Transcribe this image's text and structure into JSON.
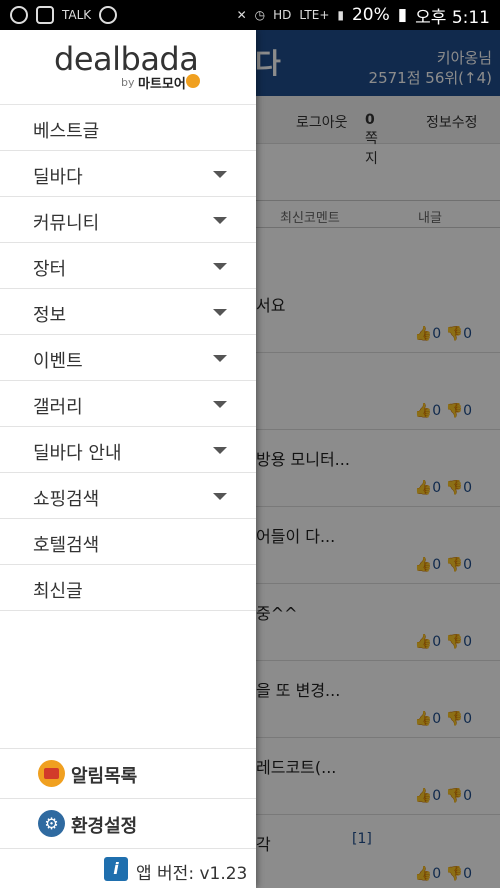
{
  "status_bar": {
    "battery": "20%",
    "time": "오후 5:11",
    "lte": "LTE+",
    "talk": "TALK",
    "hd": "HD"
  },
  "background": {
    "title": "다",
    "user_name": "키아옹님",
    "user_stats": "2571점 56위(↑4)",
    "links": {
      "logout": "로그아웃",
      "message": "쪽지",
      "message_count": "0",
      "profile": "정보수정"
    },
    "tabs": {
      "recent_comments": "최신코멘트",
      "mine": "내글"
    },
    "rows": [
      {
        "title": "서요",
        "up": "0",
        "down": "0"
      },
      {
        "title": "",
        "up": "0",
        "down": "0"
      },
      {
        "title": "방용 모니터...",
        "up": "0",
        "down": "0"
      },
      {
        "title": "어들이 다...",
        "up": "0",
        "down": "0"
      },
      {
        "title": "중^^",
        "up": "0",
        "down": "0"
      },
      {
        "title": "을 또 변경...",
        "up": "0",
        "down": "0"
      },
      {
        "title": "레드코트(...",
        "up": "0",
        "down": "0"
      },
      {
        "title": "각",
        "comments": "[1]",
        "up": "0",
        "down": "0"
      }
    ]
  },
  "drawer": {
    "logo": {
      "brand": "dealbada",
      "by": "by",
      "partner": "마트모어"
    },
    "menu": [
      {
        "label": "베스트글",
        "expandable": false
      },
      {
        "label": "딜바다",
        "expandable": true
      },
      {
        "label": "커뮤니티",
        "expandable": true
      },
      {
        "label": "장터",
        "expandable": true
      },
      {
        "label": "정보",
        "expandable": true
      },
      {
        "label": "이벤트",
        "expandable": true
      },
      {
        "label": "갤러리",
        "expandable": true
      },
      {
        "label": "딜바다 안내",
        "expandable": true
      },
      {
        "label": "쇼핑검색",
        "expandable": true
      },
      {
        "label": "호텔검색",
        "expandable": false
      },
      {
        "label": "최신글",
        "expandable": false
      }
    ],
    "alarm_label": "알림목록",
    "settings_label": "환경설정",
    "version_label": "앱 버전: v1.23",
    "accent": "#1f4e8c"
  }
}
